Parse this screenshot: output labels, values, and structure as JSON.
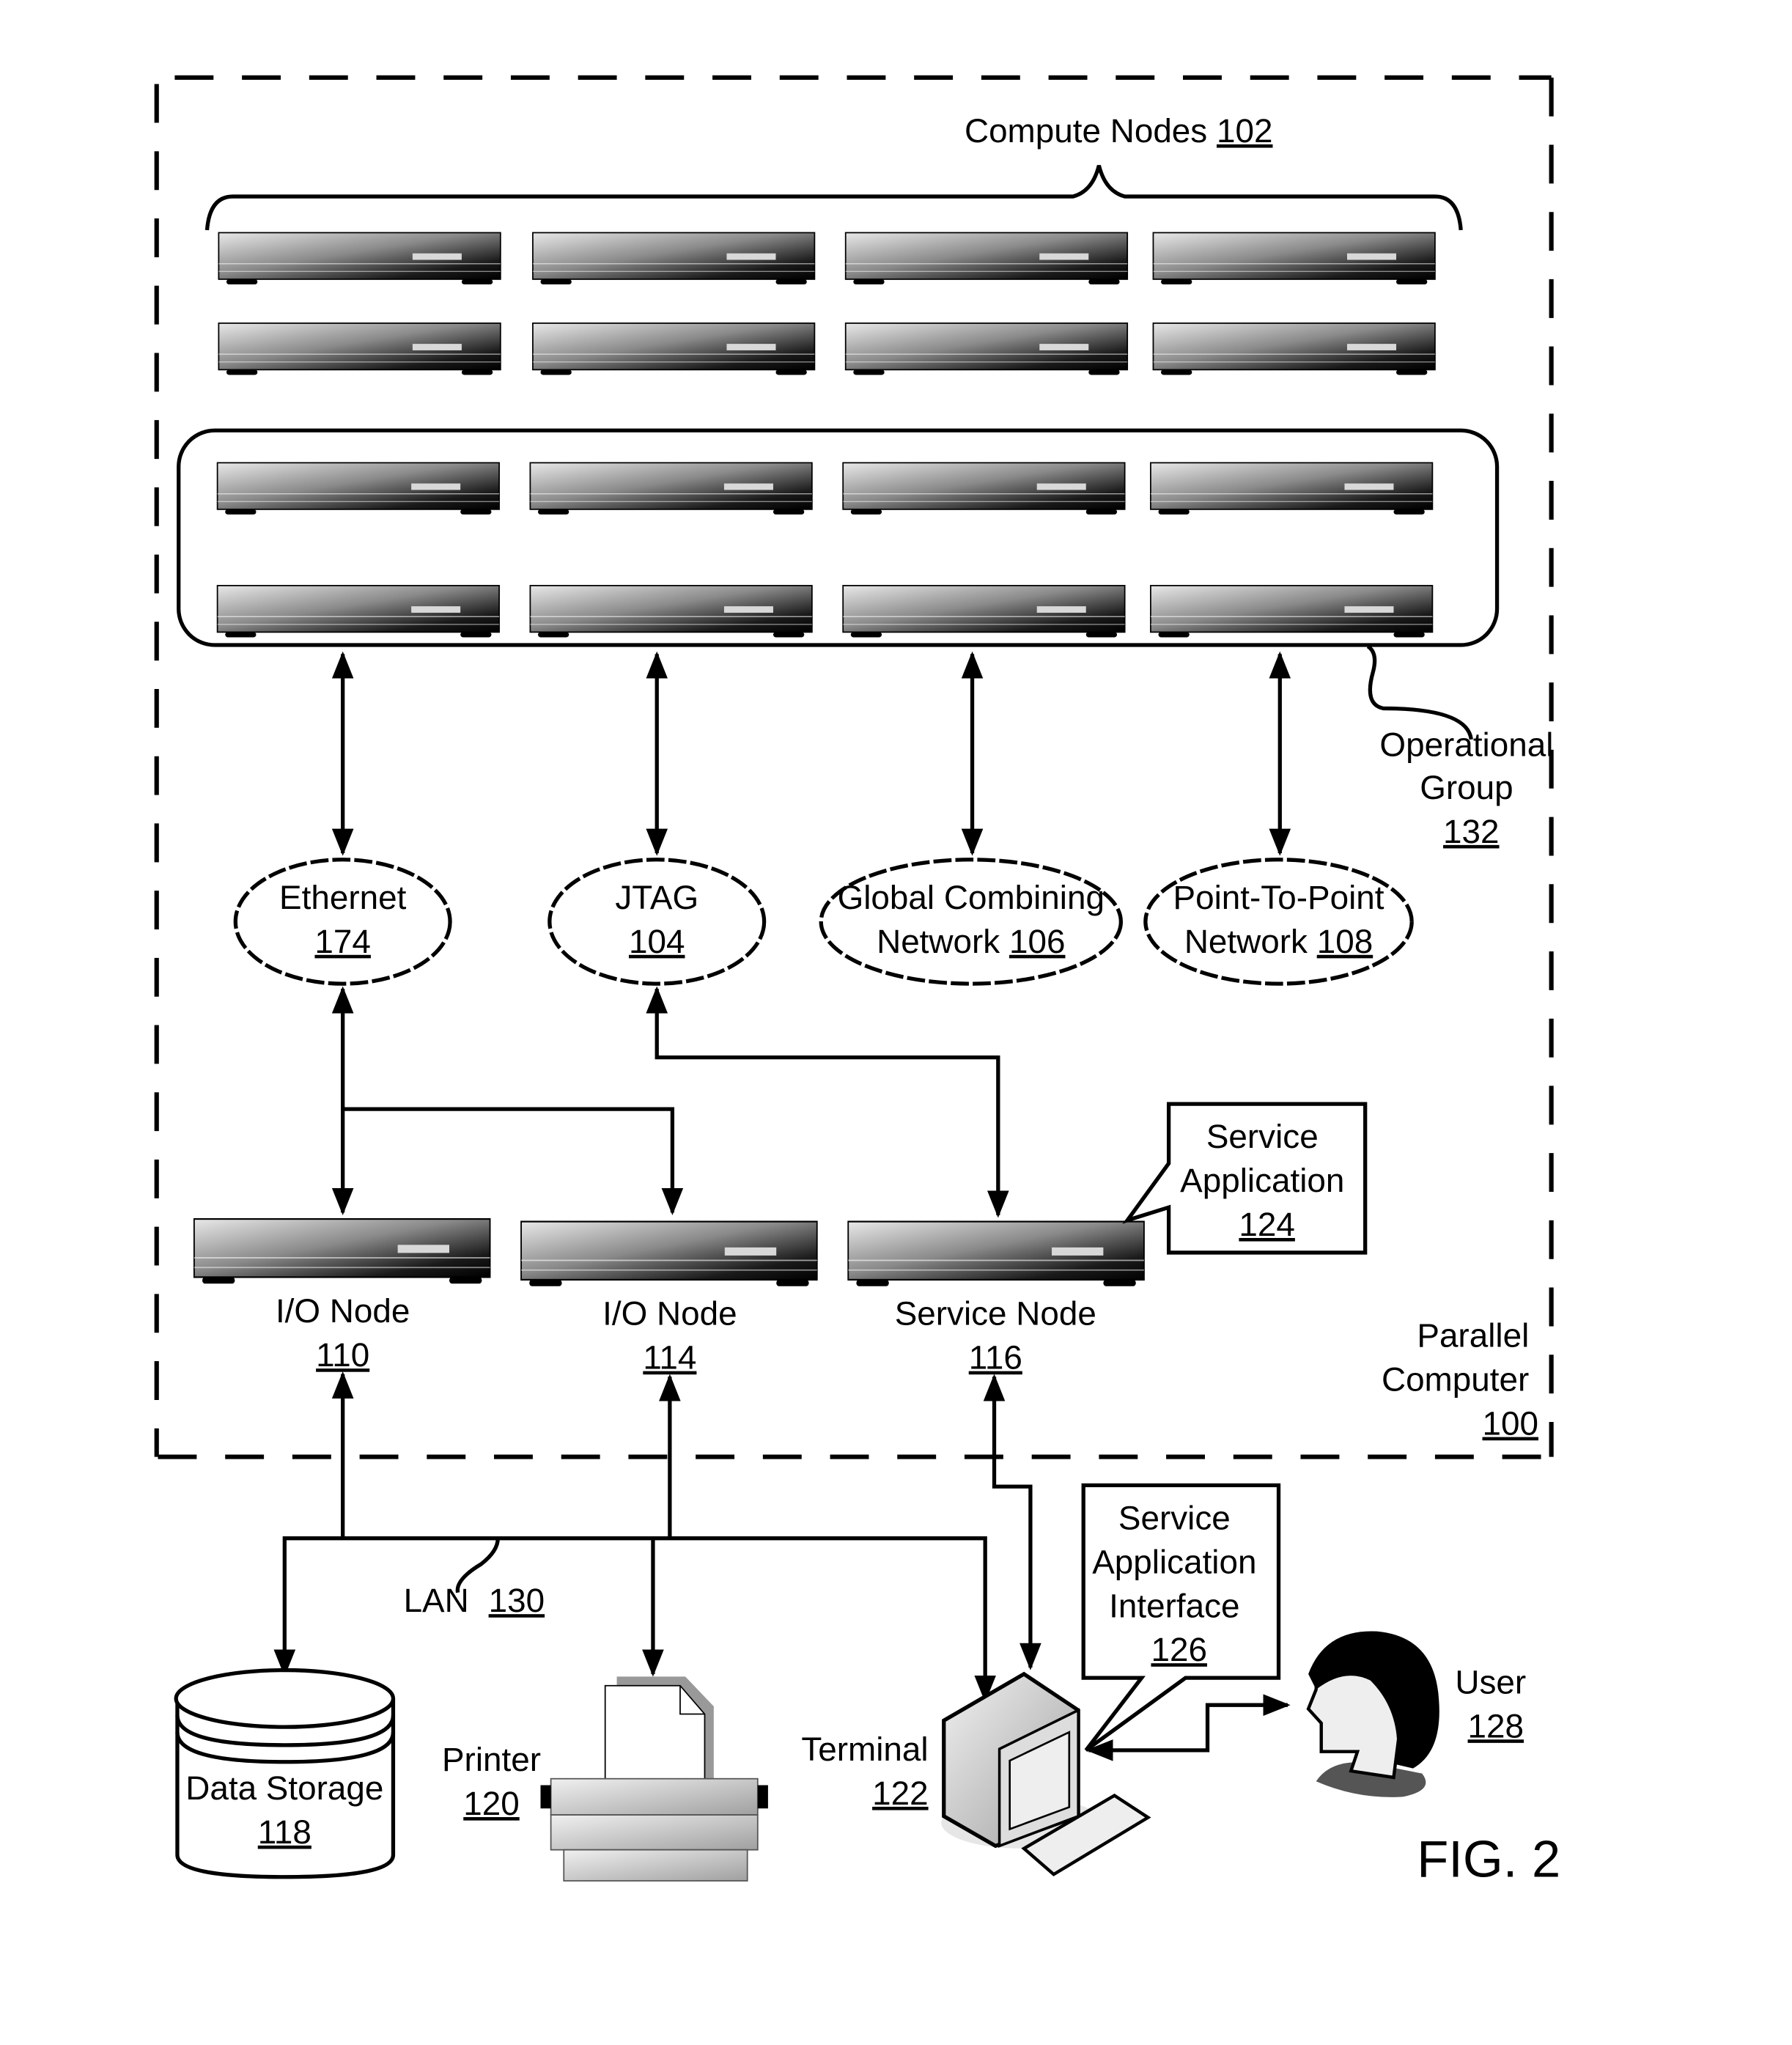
{
  "figure_label": "FIG. 2",
  "parallel_computer": {
    "label_lines": [
      "Parallel",
      "Computer"
    ],
    "ref": "100"
  },
  "compute_nodes": {
    "label": "Compute Nodes",
    "ref": "102"
  },
  "operational_group": {
    "label_lines": [
      "Operational",
      "Group"
    ],
    "ref": "132"
  },
  "networks": [
    {
      "id": "ethernet",
      "lines": [
        "Ethernet"
      ],
      "ref": "174"
    },
    {
      "id": "jtag",
      "lines": [
        "JTAG"
      ],
      "ref": "104"
    },
    {
      "id": "global-combining",
      "lines": [
        "Global Combining",
        "Network"
      ],
      "ref": "106"
    },
    {
      "id": "point-to-point",
      "lines": [
        "Point-To-Point",
        "Network"
      ],
      "ref": "108"
    }
  ],
  "nodes": [
    {
      "id": "io-node-110",
      "label": "I/O Node",
      "ref": "110"
    },
    {
      "id": "io-node-114",
      "label": "I/O Node",
      "ref": "114"
    },
    {
      "id": "service-node",
      "label": "Service Node",
      "ref": "116"
    }
  ],
  "service_application": {
    "lines": [
      "Service",
      "Application"
    ],
    "ref": "124"
  },
  "service_application_interface": {
    "lines": [
      "Service",
      "Application",
      "Interface"
    ],
    "ref": "126"
  },
  "lan": {
    "label": "LAN",
    "ref": "130"
  },
  "data_storage": {
    "label": "Data Storage",
    "ref": "118"
  },
  "printer": {
    "label": "Printer",
    "ref": "120"
  },
  "terminal": {
    "label": "Terminal",
    "ref": "122"
  },
  "user": {
    "label": "User",
    "ref": "128"
  }
}
